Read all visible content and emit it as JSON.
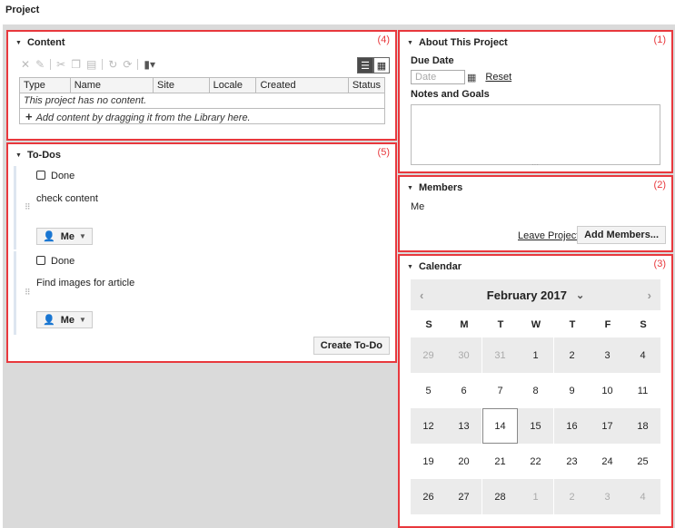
{
  "page_title": "Project",
  "content": {
    "title": "Content",
    "tag": "(4)",
    "columns": [
      "Type",
      "Name",
      "Site",
      "Locale",
      "Created",
      "Status"
    ],
    "empty_message": "This project has no content.",
    "add_hint": "Add content by dragging it from the Library here."
  },
  "todos": {
    "title": "To-Dos",
    "tag": "(5)",
    "items": [
      {
        "done_label": "Done",
        "text": "check content",
        "assignee": "Me"
      },
      {
        "done_label": "Done",
        "text": "Find images for article",
        "assignee": "Me"
      }
    ],
    "create_label": "Create To-Do"
  },
  "about": {
    "title": "About This Project",
    "tag": "(1)",
    "due_date_label": "Due Date",
    "date_placeholder": "Date",
    "reset_label": "Reset",
    "notes_label": "Notes and Goals"
  },
  "members": {
    "title": "Members",
    "tag": "(2)",
    "list": [
      "Me"
    ],
    "leave_label": "Leave Project",
    "add_label": "Add Members..."
  },
  "calendar": {
    "title": "Calendar",
    "tag": "(3)",
    "month_label": "February 2017",
    "weekdays": [
      "S",
      "M",
      "T",
      "W",
      "T",
      "F",
      "S"
    ],
    "weeks": [
      [
        "29",
        "30",
        "31",
        "1",
        "2",
        "3",
        "4"
      ],
      [
        "5",
        "6",
        "7",
        "8",
        "9",
        "10",
        "11"
      ],
      [
        "12",
        "13",
        "14",
        "15",
        "16",
        "17",
        "18"
      ],
      [
        "19",
        "20",
        "21",
        "22",
        "23",
        "24",
        "25"
      ],
      [
        "26",
        "27",
        "28",
        "1",
        "2",
        "3",
        "4"
      ]
    ],
    "today": "14"
  }
}
